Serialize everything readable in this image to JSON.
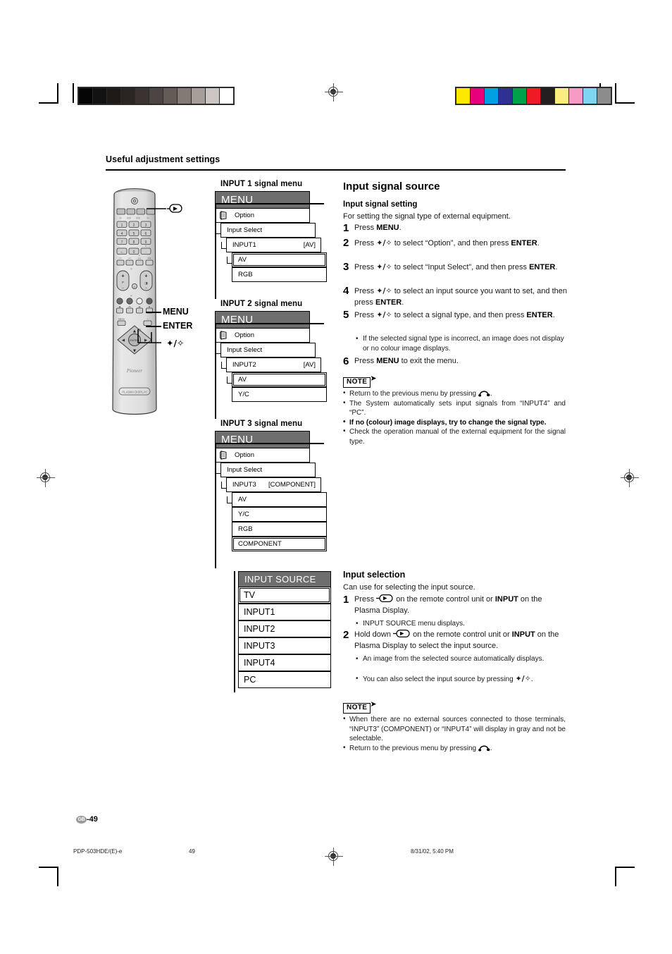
{
  "page": {
    "section_title": "Useful adjustment settings",
    "page_label": "-49",
    "page_locale": "GB"
  },
  "footer": {
    "file": "PDP-503HDE/(E)-e",
    "page_number": "49",
    "timestamp": "8/31/02, 5:40 PM"
  },
  "remote": {
    "callouts": {
      "menu": "MENU",
      "enter": "ENTER",
      "updown": "✦/✧"
    },
    "brand": "Pioneer",
    "model_label": "PLASMA DISPLAY",
    "keypad": [
      "1",
      "2",
      "3",
      "4",
      "5",
      "6",
      "7",
      "8",
      "9",
      "·/–",
      "0",
      "··"
    ]
  },
  "menus": [
    {
      "title": "INPUT 1 signal menu",
      "header": "MENU",
      "option_row": "Option",
      "input_select_row": "Input Select",
      "input_row_label": "INPUT1",
      "input_row_value": "[AV]",
      "choices": [
        "AV",
        "RGB"
      ],
      "selected": "AV"
    },
    {
      "title": "INPUT 2 signal menu",
      "header": "MENU",
      "option_row": "Option",
      "input_select_row": "Input Select",
      "input_row_label": "INPUT2",
      "input_row_value": "[AV]",
      "choices": [
        "AV",
        "Y/C"
      ],
      "selected": "AV"
    },
    {
      "title": "INPUT 3 signal menu",
      "header": "MENU",
      "option_row": "Option",
      "input_select_row": "Input Select",
      "input_row_label": "INPUT3",
      "input_row_value": "[COMPONENT]",
      "choices": [
        "AV",
        "Y/C",
        "RGB",
        "COMPONENT"
      ],
      "selected": "COMPONENT"
    }
  ],
  "input_source_menu": {
    "header": "INPUT SOURCE",
    "items": [
      "TV",
      "INPUT1",
      "INPUT2",
      "INPUT3",
      "INPUT4",
      "PC"
    ],
    "selected": "TV"
  },
  "input_signal_source": {
    "title": "Input signal source",
    "subtitle": "Input signal setting",
    "lead": "For setting the signal type of external equipment.",
    "steps": [
      {
        "num": "1",
        "parts": [
          {
            "t": "Press "
          },
          {
            "t": "MENU",
            "b": true
          },
          {
            "t": "."
          }
        ]
      },
      {
        "num": "2",
        "parts": [
          {
            "t": "Press "
          },
          {
            "t": "✦/✧",
            "a": true
          },
          {
            "t": " to select “Option”, and then press "
          },
          {
            "t": "ENTER",
            "b": true
          },
          {
            "t": "."
          }
        ]
      },
      {
        "num": "3",
        "parts": [
          {
            "t": "Press "
          },
          {
            "t": "✦/✧",
            "a": true
          },
          {
            "t": " to select “Input Select”, and then press "
          },
          {
            "t": "ENTER",
            "b": true
          },
          {
            "t": "."
          }
        ]
      },
      {
        "num": "4",
        "parts": [
          {
            "t": "Press "
          },
          {
            "t": "✦/✧",
            "a": true
          },
          {
            "t": " to select an input source you want to set, and then press "
          },
          {
            "t": "ENTER",
            "b": true
          },
          {
            "t": "."
          }
        ]
      },
      {
        "num": "5",
        "parts": [
          {
            "t": "Press "
          },
          {
            "t": "✦/✧",
            "a": true
          },
          {
            "t": " to select a signal type, and then press "
          },
          {
            "t": "ENTER",
            "b": true
          },
          {
            "t": "."
          }
        ]
      }
    ],
    "step5_bullet": "If the selected signal type is incorrect, an image does not display or no colour image displays.",
    "step6_num": "6",
    "step6_parts": [
      {
        "t": "Press "
      },
      {
        "t": "MENU",
        "b": true
      },
      {
        "t": " to exit the menu."
      }
    ],
    "note_label": "NOTE",
    "notes": [
      {
        "text": "Return to the previous menu by pressing ",
        "icon": "return-icon",
        "suffix": "."
      },
      {
        "text": "The System automatically sets input signals from “INPUT4” and “PC”."
      },
      {
        "text": "If no (colour) image displays, try to change the signal type.",
        "bold": true
      },
      {
        "text": "Check the operation manual of the external equipment for the signal type."
      }
    ]
  },
  "input_selection": {
    "subtitle": "Input selection",
    "lead": "Can use for selecting the input source.",
    "step1_num": "1",
    "step1_a": "Press ",
    "step1_b": " on the remote control unit or ",
    "step1_input": "INPUT",
    "step1_c": " on the Plasma Display.",
    "step1_bullet": "INPUT SOURCE menu displays.",
    "step2_num": "2",
    "step2_a": "Hold down ",
    "step2_b": " on the remote control unit or ",
    "step2_input": "INPUT",
    "step2_c": " on the Plasma Display to select the input source.",
    "step2_bullets": [
      "An image from the selected source automatically displays."
    ],
    "step2_bullet_arrow_pre": "You can also select the input source by pressing ",
    "step2_bullet_arrow": "✦/✧",
    "step2_bullet_arrow_post": ".",
    "note_label": "NOTE",
    "notes": [
      {
        "text": "When there are no external sources connected to those terminals, “INPUT3” (COMPONENT) or “INPUT4” will display in gray and not be selectable."
      },
      {
        "text": "Return to the previous menu by pressing ",
        "icon": "return-icon",
        "suffix": "."
      }
    ]
  },
  "print_marks": {
    "gray_wedge": [
      "#050505",
      "#121212",
      "#1d1a18",
      "#2a2523",
      "#3a3330",
      "#4d4542",
      "#655b56",
      "#837a75",
      "#a79e99",
      "#cdc6c2",
      "#ffffff"
    ],
    "color_bars": [
      "#ffe800",
      "#e6007e",
      "#00a0e2",
      "#2e3191",
      "#00a14b",
      "#ed1c24",
      "#231f20",
      "#fbed7e",
      "#f89ac6",
      "#7fd4f2",
      "#8c8c8c"
    ]
  }
}
